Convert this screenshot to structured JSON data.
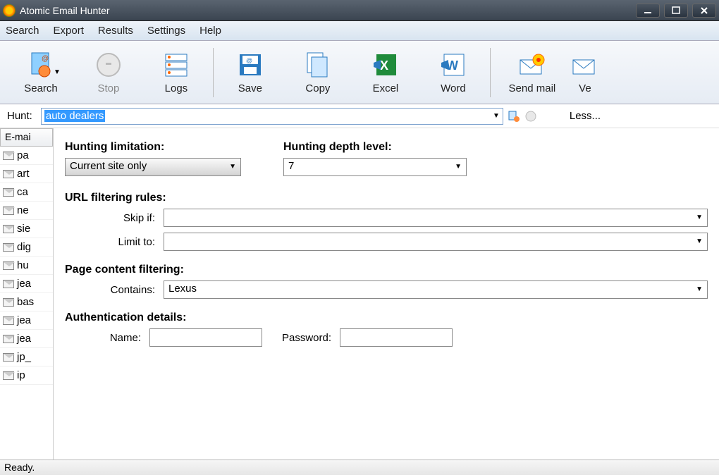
{
  "window": {
    "title": "Atomic Email Hunter"
  },
  "menu": {
    "search": "Search",
    "export": "Export",
    "results": "Results",
    "settings": "Settings",
    "help": "Help"
  },
  "toolbar": {
    "search": "Search",
    "stop": "Stop",
    "logs": "Logs",
    "save": "Save",
    "copy": "Copy",
    "excel": "Excel",
    "word": "Word",
    "sendmail": "Send mail",
    "verify": "Ve"
  },
  "hunt": {
    "label": "Hunt:",
    "value": "auto dealers",
    "less": "Less..."
  },
  "sidebar": {
    "header": "E-mai",
    "items": [
      "pa",
      "art",
      "ca",
      "ne",
      "sie",
      "dig",
      "hu",
      "jea",
      "bas",
      "jea",
      "jea",
      "jp_",
      "ip"
    ]
  },
  "panel": {
    "limitation_title": "Hunting limitation:",
    "limitation_value": "Current site only",
    "depth_title": "Hunting depth level:",
    "depth_value": "7",
    "url_rules_title": "URL filtering rules:",
    "skip_if": "Skip if:",
    "limit_to": "Limit to:",
    "content_filter_title": "Page content filtering:",
    "contains_label": "Contains:",
    "contains_value": "Lexus",
    "auth_title": "Authentication details:",
    "name_label": "Name:",
    "password_label": "Password:"
  },
  "status": {
    "text": "Ready."
  }
}
